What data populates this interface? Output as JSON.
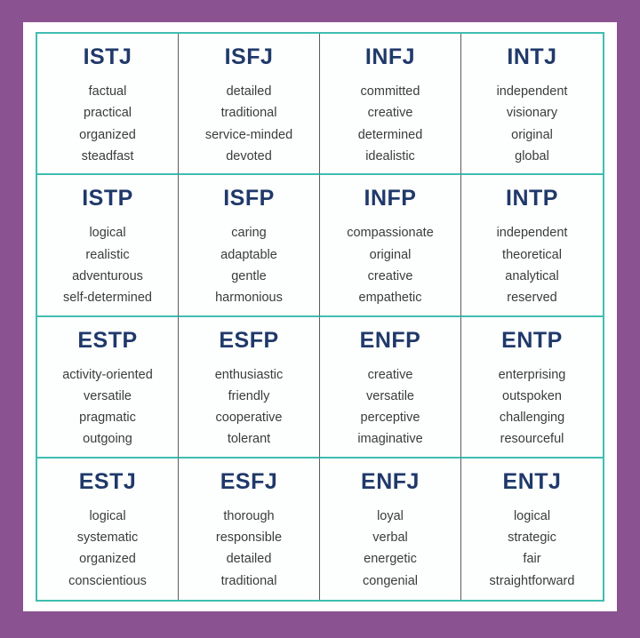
{
  "graphic": {
    "kind": "mbti-sixteen-types-grid",
    "outer_background_color": "#8b5291",
    "card_background_color": "#ffffff",
    "grid_line_color": "#3fbdb0",
    "column_divider_color": "#5c5c5c",
    "title_color": "#20396a",
    "trait_color": "#3b3b3b",
    "columns": 4,
    "rows": 4
  },
  "cells": [
    {
      "type": "ISTJ",
      "traits": [
        "factual",
        "practical",
        "organized",
        "steadfast"
      ]
    },
    {
      "type": "ISFJ",
      "traits": [
        "detailed",
        "traditional",
        "service-minded",
        "devoted"
      ]
    },
    {
      "type": "INFJ",
      "traits": [
        "committed",
        "creative",
        "determined",
        "idealistic"
      ]
    },
    {
      "type": "INTJ",
      "traits": [
        "independent",
        "visionary",
        "original",
        "global"
      ]
    },
    {
      "type": "ISTP",
      "traits": [
        "logical",
        "realistic",
        "adventurous",
        "self-determined"
      ]
    },
    {
      "type": "ISFP",
      "traits": [
        "caring",
        "adaptable",
        "gentle",
        "harmonious"
      ]
    },
    {
      "type": "INFP",
      "traits": [
        "compassionate",
        "original",
        "creative",
        "empathetic"
      ]
    },
    {
      "type": "INTP",
      "traits": [
        "independent",
        "theoretical",
        "analytical",
        "reserved"
      ]
    },
    {
      "type": "ESTP",
      "traits": [
        "activity-oriented",
        "versatile",
        "pragmatic",
        "outgoing"
      ]
    },
    {
      "type": "ESFP",
      "traits": [
        "enthusiastic",
        "friendly",
        "cooperative",
        "tolerant"
      ]
    },
    {
      "type": "ENFP",
      "traits": [
        "creative",
        "versatile",
        "perceptive",
        "imaginative"
      ]
    },
    {
      "type": "ENTP",
      "traits": [
        "enterprising",
        "outspoken",
        "challenging",
        "resourceful"
      ]
    },
    {
      "type": "ESTJ",
      "traits": [
        "logical",
        "systematic",
        "organized",
        "conscientious"
      ]
    },
    {
      "type": "ESFJ",
      "traits": [
        "thorough",
        "responsible",
        "detailed",
        "traditional"
      ]
    },
    {
      "type": "ENFJ",
      "traits": [
        "loyal",
        "verbal",
        "energetic",
        "congenial"
      ]
    },
    {
      "type": "ENTJ",
      "traits": [
        "logical",
        "strategic",
        "fair",
        "straightforward"
      ]
    }
  ]
}
